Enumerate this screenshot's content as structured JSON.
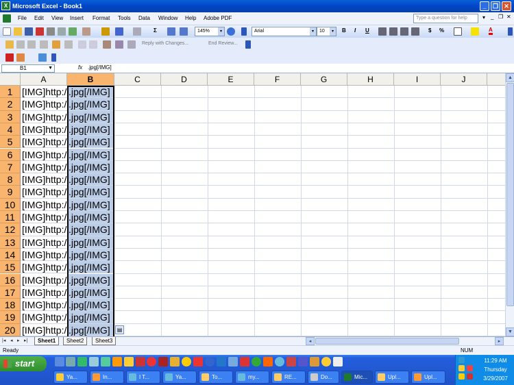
{
  "window": {
    "title": "Microsoft Excel - Book1",
    "app_icon_label": "X"
  },
  "menu": {
    "items": [
      "File",
      "Edit",
      "View",
      "Insert",
      "Format",
      "Tools",
      "Data",
      "Window",
      "Help",
      "Adobe PDF"
    ],
    "ask_placeholder": "Type a question for help"
  },
  "toolbar": {
    "zoom": "145%",
    "font_name": "Arial",
    "font_size": "10",
    "bold": "B",
    "italic": "I",
    "underline": "U",
    "currency": "$",
    "percent": "%",
    "sum": "Σ",
    "reply_with_changes": "Reply with Changes...",
    "end_review": "End Review..."
  },
  "formula_bar": {
    "name_box": "B1",
    "fx": "fx",
    "value": ".jpg[/IMG]"
  },
  "columns": [
    "A",
    "B",
    "C",
    "D",
    "E",
    "F",
    "G",
    "H",
    "I",
    "J"
  ],
  "rows": [
    "1",
    "2",
    "3",
    "4",
    "5",
    "6",
    "7",
    "8",
    "9",
    "10",
    "11",
    "12",
    "13",
    "14",
    "15",
    "16",
    "17",
    "18",
    "19",
    "20"
  ],
  "cells": {
    "A": "[IMG]http:/",
    "B": ".jpg[/IMG]"
  },
  "sheet_tabs": [
    "Sheet1",
    "Sheet2",
    "Sheet3"
  ],
  "status": {
    "left": "Ready",
    "num": "NUM"
  },
  "taskbar": {
    "start": "start",
    "tasks": [
      "Ya...",
      "In...",
      "I T...",
      "Ya...",
      "To...",
      "my...",
      "RE...",
      "Do...",
      "Mic...",
      "Upl...",
      "Upl..."
    ],
    "clock_time": "11:29 AM",
    "clock_day": "Thursday",
    "clock_date": "3/29/2007"
  },
  "colors": {
    "title_blue": "#0046c8",
    "selected_header": "#f9b56e",
    "selection_fill": "#bccde8",
    "start_green": "#2f8f2e"
  }
}
